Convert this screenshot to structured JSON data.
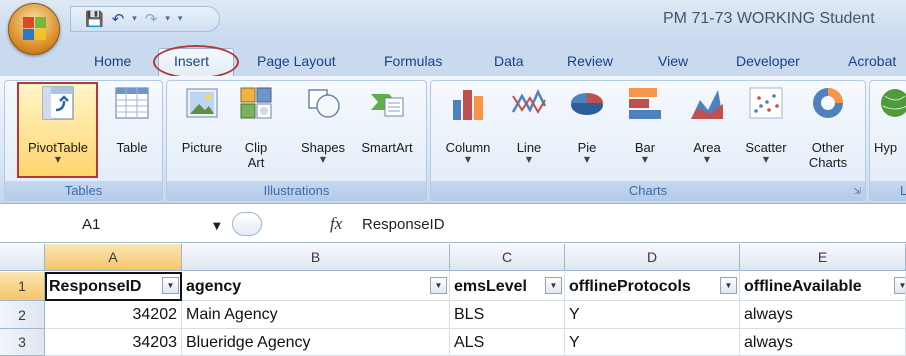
{
  "window": {
    "title": "PM 71-73 WORKING Student"
  },
  "tabs": [
    "Home",
    "Insert",
    "Page Layout",
    "Formulas",
    "Data",
    "Review",
    "View",
    "Developer",
    "Acrobat"
  ],
  "ribbon": {
    "groups": {
      "tables": "Tables",
      "illustrations": "Illustrations",
      "charts": "Charts",
      "links_partial": "L"
    },
    "buttons": {
      "pivottable": "PivotTable",
      "table": "Table",
      "picture": "Picture",
      "clip_art": "Clip Art",
      "shapes": "Shapes",
      "smartart": "SmartArt",
      "column": "Column",
      "line": "Line",
      "pie": "Pie",
      "bar": "Bar",
      "area": "Area",
      "scatter": "Scatter",
      "other_charts": "Other Charts",
      "hyperlink_partial": "Hyp"
    }
  },
  "formula_bar": {
    "name_box": "A1",
    "fx": "fx",
    "content": "ResponseID"
  },
  "grid": {
    "columns": [
      "A",
      "B",
      "C",
      "D",
      "E"
    ],
    "rows": [
      "1",
      "2",
      "3"
    ],
    "headers": [
      "ResponseID",
      "agency",
      "emsLevel",
      "offlineProtocols",
      "offlineAvailable"
    ],
    "data": [
      [
        "34202",
        "Main Agency",
        "BLS",
        "Y",
        "always"
      ],
      [
        "34203",
        "Blueridge Agency",
        "ALS",
        "Y",
        "always"
      ]
    ]
  },
  "colors": {
    "accent_red": "#b23a3a",
    "tab_text": "#15428b",
    "ribbon_bg": "#dce8f6"
  }
}
